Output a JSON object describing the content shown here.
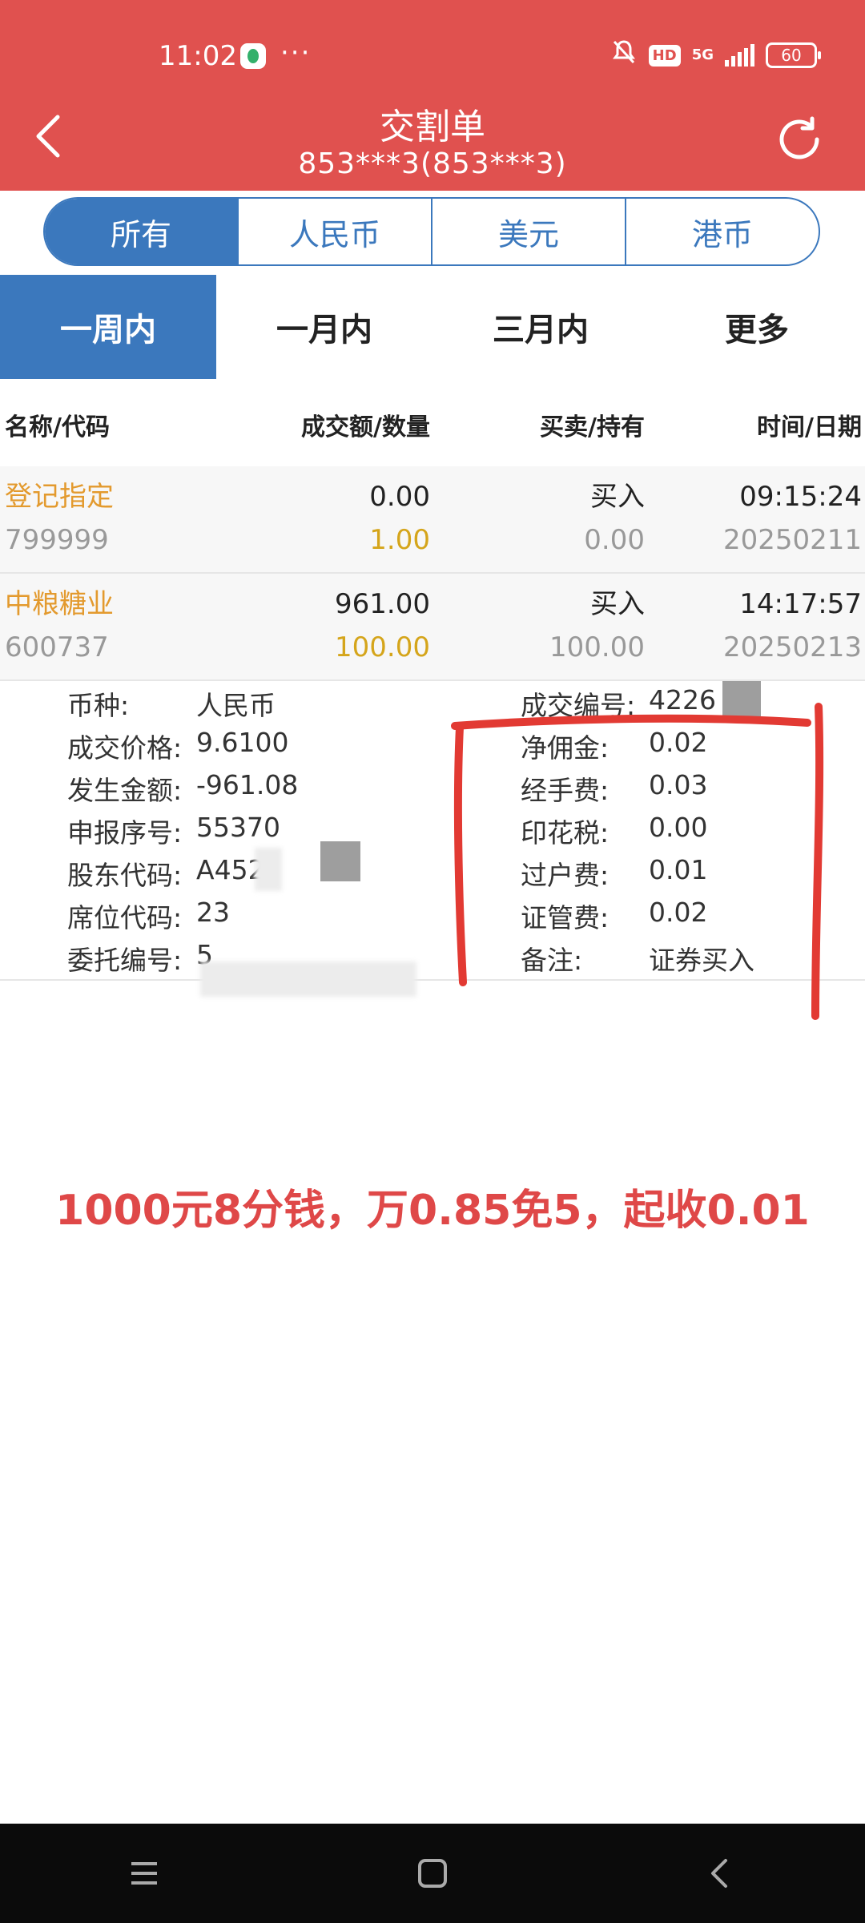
{
  "status_bar": {
    "time": "11:02",
    "dots": "···",
    "hd": "HD",
    "network": "5G",
    "battery": "60"
  },
  "header": {
    "title": "交割单",
    "subtitle": "853***3(853***3)"
  },
  "currency_tabs": [
    "所有",
    "人民币",
    "美元",
    "港币"
  ],
  "period_tabs": [
    "一周内",
    "一月内",
    "三月内",
    "更多"
  ],
  "table": {
    "headers": [
      "名称/代码",
      "成交额/数量",
      "买卖/持有",
      "时间/日期"
    ],
    "rows": [
      {
        "name": "登记指定",
        "code": "799999",
        "amount": "0.00",
        "quantity": "1.00",
        "side": "买入",
        "hold": "0.00",
        "time": "09:15:24",
        "date": "20250211"
      },
      {
        "name": "中粮糖业",
        "code": "600737",
        "amount": "961.00",
        "quantity": "100.00",
        "side": "买入",
        "hold": "100.00",
        "time": "14:17:57",
        "date": "20250213"
      }
    ]
  },
  "detail": {
    "left": [
      {
        "label": "币种:",
        "value": "人民币"
      },
      {
        "label": "成交价格:",
        "value": "9.6100"
      },
      {
        "label": "发生金额:",
        "value": "-961.08"
      },
      {
        "label": "申报序号:",
        "value": "55370"
      },
      {
        "label": "股东代码:",
        "value": "A452"
      },
      {
        "label": "席位代码:",
        "value": "23"
      },
      {
        "label": "委托编号:",
        "value": "5"
      }
    ],
    "right": [
      {
        "label": "成交编号:",
        "value": "4226"
      },
      {
        "label": "净佣金:",
        "value": "0.02"
      },
      {
        "label": "经手费:",
        "value": "0.03"
      },
      {
        "label": "印花税:",
        "value": "0.00"
      },
      {
        "label": "过户费:",
        "value": "0.01"
      },
      {
        "label": "证管费:",
        "value": "0.02"
      },
      {
        "label": "备注:",
        "value": "证券买入"
      }
    ]
  },
  "annotation": "1000元8分钱，万0.85免5，起收0.01",
  "colors": {
    "header_red": "#e0514f",
    "accent_blue": "#3b78bd",
    "name_orange": "#e39a2e",
    "quantity_yellow": "#d5a51b",
    "annotation_red": "#df4848"
  }
}
